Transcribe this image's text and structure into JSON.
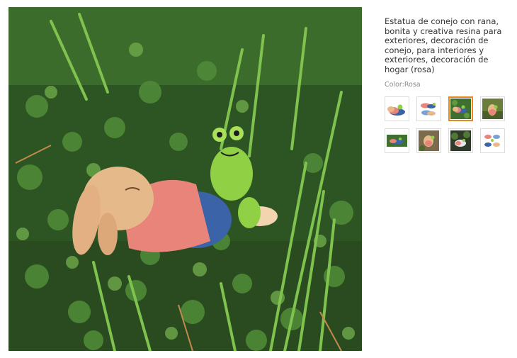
{
  "product": {
    "title": "Estatua de conejo con rana, bonita y creativa resina para exteriores, decoración de conejo, para interiores y exteriores, decoración de hogar (rosa)",
    "color_label": "Color:",
    "color_value": "Rosa"
  },
  "thumbnails": [
    {
      "icon": "rabbit-lying-white-bg",
      "selected": false
    },
    {
      "icon": "rabbit-pair-white-bg",
      "selected": false
    },
    {
      "icon": "rabbit-on-grass",
      "selected": true
    },
    {
      "icon": "rabbit-sitting-garden",
      "selected": false
    },
    {
      "icon": "rabbit-on-grass-wide",
      "selected": false
    },
    {
      "icon": "rabbit-on-ground",
      "selected": false
    },
    {
      "icon": "rabbit-in-plants",
      "selected": false
    },
    {
      "icon": "rabbit-variants-white-bg",
      "selected": false
    }
  ],
  "colors": {
    "selected_border": "#e58a1f",
    "thumb_border": "#dcdcdc",
    "title_text": "#333333",
    "muted_text": "#8a8a8a"
  }
}
